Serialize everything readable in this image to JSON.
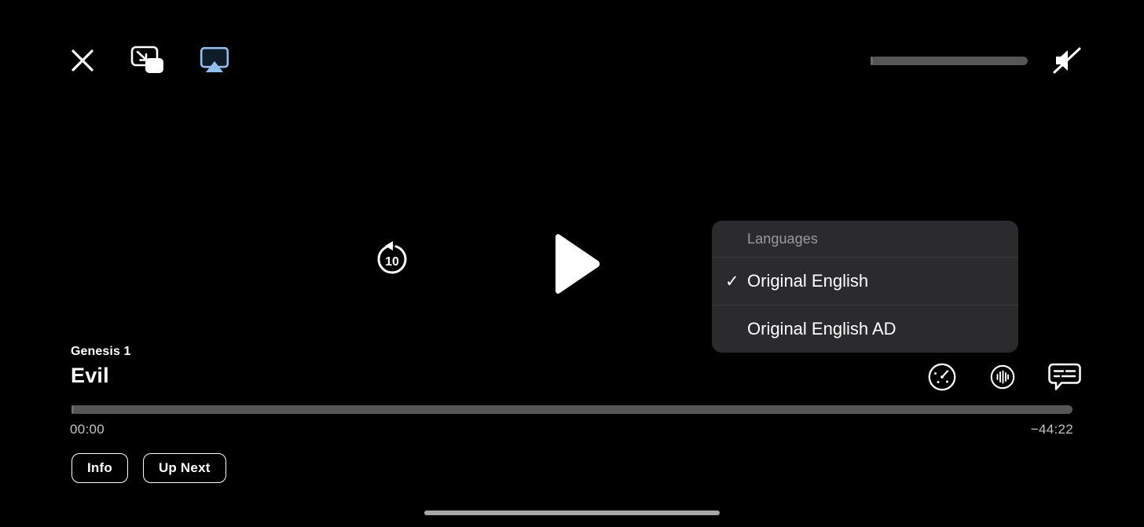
{
  "app": {
    "screen_name": "video-player",
    "background_color": "#000000"
  },
  "top_bar": {
    "close_label": "×",
    "icons": [
      {
        "name": "close-icon",
        "label": "Close"
      },
      {
        "name": "picture-in-picture-icon",
        "label": "Picture in Picture"
      },
      {
        "name": "airplay-icon",
        "label": "AirPlay",
        "color": "#8fc0f0",
        "active": true
      }
    ],
    "volume": {
      "label": "Volume",
      "value": 0,
      "max": 100,
      "muted": true,
      "mute_icon": "speaker-mute-icon",
      "track_color": "#565656"
    }
  },
  "center": {
    "skip_back": {
      "label": "10",
      "name": "skip-back-10-icon",
      "seconds": 10
    },
    "play": {
      "label": "Play",
      "name": "play-icon",
      "state": "paused"
    }
  },
  "languages_menu": {
    "header": "Languages",
    "items": [
      {
        "label": "Original English",
        "selected": true,
        "check": "✓"
      },
      {
        "label": "Original English AD",
        "selected": false,
        "check": "✓"
      }
    ],
    "background_color": "#2b2b2d"
  },
  "now_playing": {
    "subtitle": "Genesis 1",
    "title": "Evil"
  },
  "bottom_right_icons": [
    {
      "name": "playback-speed-icon",
      "label": "Playback Speed"
    },
    {
      "name": "audio-track-icon",
      "label": "Audio"
    },
    {
      "name": "subtitles-icon",
      "label": "Subtitles"
    }
  ],
  "scrubber": {
    "label": "Playback progress",
    "progress_percent": 0,
    "elapsed": "00:00",
    "remaining": "−44:22"
  },
  "bottom_buttons": [
    {
      "label": "Info",
      "name": "info-button"
    },
    {
      "label": "Up Next",
      "name": "up-next-button"
    }
  ],
  "home_indicator": {
    "label": "Home indicator",
    "color": "#a8a8a8"
  }
}
